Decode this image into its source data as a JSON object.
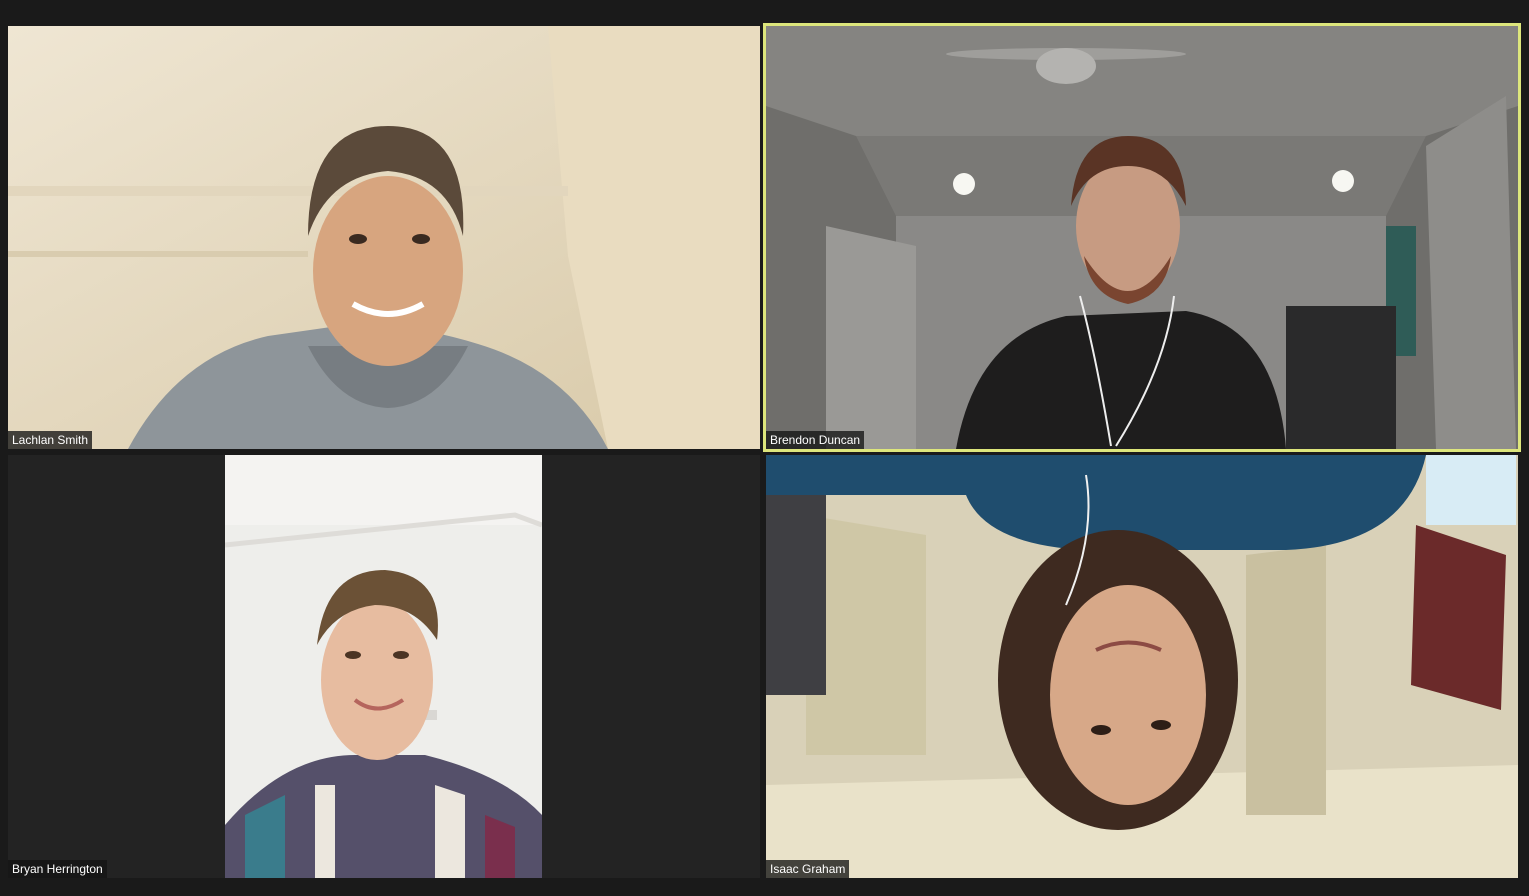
{
  "participants": [
    {
      "name": "Lachlan Smith",
      "speaking": false
    },
    {
      "name": "Brendon Duncan",
      "speaking": true
    },
    {
      "name": "Bryan Herrington",
      "speaking": false
    },
    {
      "name": "Isaac Graham",
      "speaking": false
    }
  ],
  "colors": {
    "background": "#1a1a1a",
    "tile": "#232323",
    "active_speaker_border": "#dde67c",
    "name_tag_text": "#ffffff"
  }
}
